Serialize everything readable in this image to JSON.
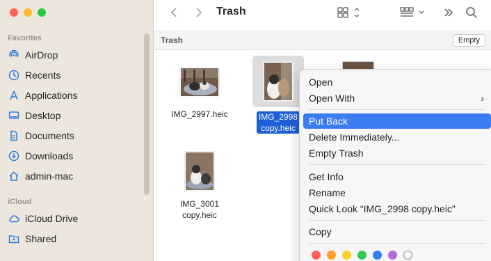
{
  "sidebar": {
    "favorites_label": "Favorites",
    "favorites": [
      {
        "label": "AirDrop",
        "icon": "airdrop-icon"
      },
      {
        "label": "Recents",
        "icon": "clock-icon"
      },
      {
        "label": "Applications",
        "icon": "applications-icon"
      },
      {
        "label": "Desktop",
        "icon": "desktop-icon"
      },
      {
        "label": "Documents",
        "icon": "document-icon"
      },
      {
        "label": "Downloads",
        "icon": "download-icon"
      },
      {
        "label": "admin-mac",
        "icon": "home-icon"
      }
    ],
    "icloud_label": "iCloud",
    "icloud": [
      {
        "label": "iCloud Drive",
        "icon": "cloud-icon"
      },
      {
        "label": "Shared",
        "icon": "shared-folder-icon"
      }
    ]
  },
  "toolbar": {
    "title": "Trash"
  },
  "pathbar": {
    "label": "Trash",
    "empty_button": "Empty"
  },
  "files": [
    {
      "name_line1": "IMG_2997.heic",
      "name_line2": "",
      "selected": false
    },
    {
      "name_line1": "IMG_2998",
      "name_line2": "copy.heic",
      "selected": true
    },
    {
      "name_line1": "IMG_3001",
      "name_line2": "copy.heic",
      "selected": false
    }
  ],
  "context_menu": {
    "open": "Open",
    "open_with": "Open With",
    "put_back": "Put Back",
    "delete_immediately": "Delete Immediately...",
    "empty_trash": "Empty Trash",
    "get_info": "Get Info",
    "rename": "Rename",
    "quick_look": "Quick Look “IMG_2998 copy.heic”",
    "copy": "Copy",
    "tag_colors": [
      "#fe5f57",
      "#fe9f2e",
      "#fcd12a",
      "#34c759",
      "#2f80ed",
      "#b26ddb",
      "none"
    ]
  },
  "colors": {
    "sidebar_icon": "#2f7ce0",
    "selection": "#3b7cf0"
  }
}
